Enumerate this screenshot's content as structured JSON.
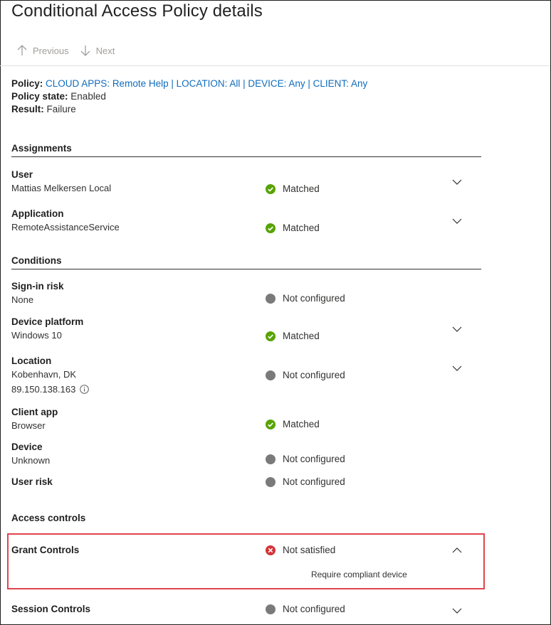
{
  "title": "Conditional Access Policy details",
  "nav": {
    "previous": "Previous",
    "next": "Next"
  },
  "summary": {
    "policy_label": "Policy:",
    "policy_value": "CLOUD APPS: Remote Help | LOCATION: All | DEVICE: Any | CLIENT: Any",
    "state_label": "Policy state:",
    "state_value": "Enabled",
    "result_label": "Result:",
    "result_value": "Failure"
  },
  "sections": {
    "assignments": "Assignments",
    "conditions": "Conditions",
    "access_controls": "Access controls"
  },
  "rows": {
    "user": {
      "name": "User",
      "value": "Mattias Melkersen Local",
      "status": "Matched"
    },
    "application": {
      "name": "Application",
      "value": "RemoteAssistanceService",
      "status": "Matched"
    },
    "signin_risk": {
      "name": "Sign-in risk",
      "value": "None",
      "status": "Not configured"
    },
    "device_platform": {
      "name": "Device platform",
      "value": "Windows 10",
      "status": "Matched"
    },
    "location": {
      "name": "Location",
      "value": "Kobenhavn, DK",
      "ip": "89.150.138.163",
      "status": "Not configured"
    },
    "client_app": {
      "name": "Client app",
      "value": "Browser",
      "status": "Matched"
    },
    "device": {
      "name": "Device",
      "value": "Unknown",
      "status": "Not configured"
    },
    "user_risk": {
      "name": "User risk",
      "status": "Not configured"
    },
    "grant_controls": {
      "name": "Grant Controls",
      "status": "Not satisfied",
      "detail": "Require compliant device"
    },
    "session_controls": {
      "name": "Session Controls",
      "status": "Not configured"
    }
  },
  "colors": {
    "matched": "#57a300",
    "not_configured": "#7a7a7a",
    "not_satisfied": "#d13438",
    "link": "#0f6cbd",
    "highlight": "#e0444d"
  }
}
